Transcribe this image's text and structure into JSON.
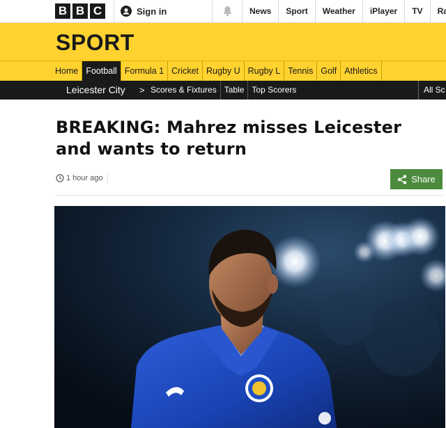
{
  "header": {
    "logo_letters": [
      "B",
      "B",
      "C"
    ],
    "signin_label": "Sign in",
    "nav": [
      "News",
      "Sport",
      "Weather",
      "iPlayer",
      "TV",
      "Rad"
    ]
  },
  "sport": {
    "title": "SPORT",
    "nav": [
      {
        "label": "Home",
        "active": false
      },
      {
        "label": "Football",
        "active": true
      },
      {
        "label": "Formula 1",
        "active": false
      },
      {
        "label": "Cricket",
        "active": false
      },
      {
        "label": "Rugby U",
        "active": false
      },
      {
        "label": "Rugby L",
        "active": false
      },
      {
        "label": "Tennis",
        "active": false
      },
      {
        "label": "Golf",
        "active": false
      },
      {
        "label": "Athletics",
        "active": false
      }
    ]
  },
  "subnav": {
    "team": "Leicester City",
    "chevron": ">",
    "links": [
      "Scores & Fixtures",
      "Table",
      "Top Scorers"
    ],
    "all_label": "All Sc"
  },
  "article": {
    "headline": "BREAKING: Mahrez misses Leicester and wants to return",
    "timestamp": "1 hour ago",
    "share_label": "Share",
    "image_alt": "Riyad Mahrez in a blue Leicester City shirt at night under stadium lights"
  },
  "colors": {
    "sport_yellow": "#ffd230",
    "dark": "#1a1a1a",
    "share_green": "#4c8a3e",
    "leicester_blue": "#1f4fc4"
  }
}
